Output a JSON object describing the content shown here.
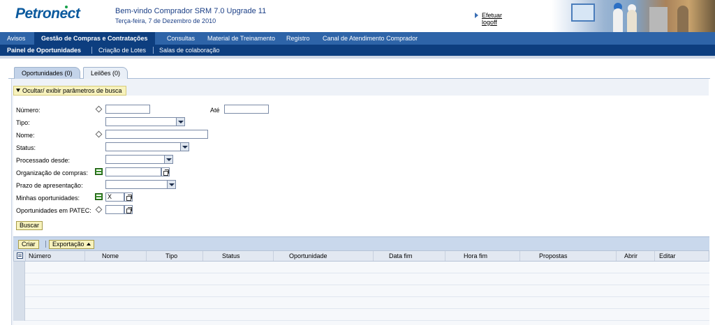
{
  "header": {
    "logo_text": "Petronect",
    "welcome": "Bem-vindo Comprador SRM 7.0 Upgrade 11",
    "date": "Terça-feira, 7 de Dezembro de 2010",
    "logoff": "Efetuar logoff"
  },
  "nav": {
    "top": [
      {
        "label": "Avisos"
      },
      {
        "label": "Gestão de Compras e Contratações",
        "active": true
      },
      {
        "label": "Consultas"
      },
      {
        "label": "Material de Treinamento"
      },
      {
        "label": "Registro"
      },
      {
        "label": "Canal de Atendimento Comprador"
      }
    ],
    "sub": [
      {
        "label": "Painel de Oportunidades",
        "active": true
      },
      {
        "label": "Criação de Lotes"
      },
      {
        "label": "Salas de colaboração"
      }
    ]
  },
  "tabs": [
    {
      "label": "Oportunidades (0)",
      "active": true
    },
    {
      "label": "Leilões (0)"
    }
  ],
  "search": {
    "toggle_label": "Ocultar/ exibir parâmetros de busca",
    "fields": {
      "numero": "Número:",
      "ate": "Até",
      "tipo": "Tipo:",
      "nome": "Nome:",
      "status": "Status:",
      "processado": "Processado desde:",
      "organizacao": "Organização de compras:",
      "prazo": "Prazo de apresentação:",
      "minhas": "Minhas oportunidades:",
      "minhas_value": "X",
      "patec": "Oportunidades em PATEC:"
    },
    "buscar": "Buscar"
  },
  "toolbar": {
    "criar": "Criar",
    "exportacao": "Exportação"
  },
  "table": {
    "columns": [
      "Número",
      "Nome",
      "Tipo",
      "Status",
      "Oportunidade",
      "Data fim",
      "Hora fim",
      "Propostas",
      "Abrir",
      "Editar"
    ]
  }
}
